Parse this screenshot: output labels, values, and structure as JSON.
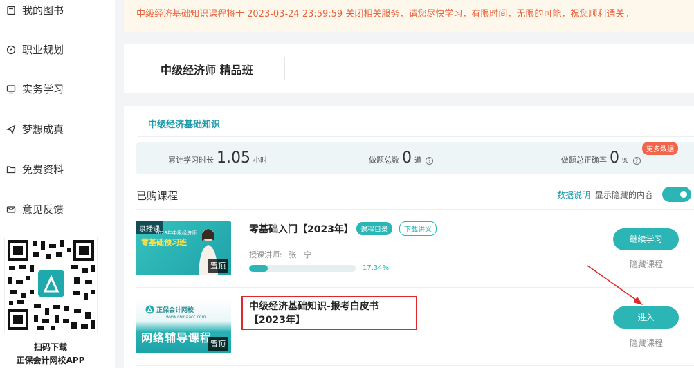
{
  "sidebar": {
    "items": [
      {
        "label": "我的图书",
        "icon": "book-icon"
      },
      {
        "label": "职业规划",
        "icon": "compass-icon"
      },
      {
        "label": "实务学习",
        "icon": "monitor-icon"
      },
      {
        "label": "梦想成真",
        "icon": "paper-plane-icon"
      },
      {
        "label": "免费资料",
        "icon": "folder-icon"
      },
      {
        "label": "意见反馈",
        "icon": "mail-icon"
      }
    ],
    "qr_caption_1": "扫码下载",
    "qr_caption_2": "正保会计网校APP"
  },
  "notice": {
    "text": "中级经济基础知识课程将于 2023-03-24 23:59:59 关闭相关服务，请您尽快学习，有限时间，无限的可能，祝您顺利通关。"
  },
  "course_header": {
    "title": "中级经济师 精品班"
  },
  "tab": {
    "label": "中级经济基础知识"
  },
  "stats": {
    "study_time_label": "累计学习时长",
    "study_time_value": "1.05",
    "study_time_unit": "小时",
    "questions_label": "做题总数",
    "questions_value": "0",
    "questions_unit": "道",
    "accuracy_label": "做题总正确率",
    "accuracy_value": "0",
    "accuracy_unit": "%",
    "more_badge": "更多数据"
  },
  "purchased": {
    "heading": "已购课程",
    "data_link": "数据说明",
    "show_hidden_label": "显示隐藏的内容",
    "show_hidden_on": true
  },
  "courses": [
    {
      "name": "零基础入门【2023年】",
      "pill_catalog": "课程目录",
      "pill_handout": "下载讲义",
      "teacher_label": "授课讲师:",
      "teacher_name": "张　宁",
      "progress_percent": 17.34,
      "progress_text": "17.34%",
      "thumb_tag": "录播课",
      "thumb_title": "零基础预习班",
      "thumb_sub": "2023年中级经济师",
      "cover_badge": "置顶",
      "button": "继续学习",
      "hide": "隐藏课程"
    },
    {
      "name": "中级经济基础知识-报考白皮书【2023年】",
      "thumb_logo": "正保会计网校",
      "thumb_sub": "www.chinaacc.com",
      "thumb_title": "网络辅导课程",
      "cover_badge": "置顶",
      "button": "进入",
      "hide": "隐藏课程"
    }
  ],
  "colors": {
    "accent": "#2bb5b5",
    "notice_text": "#e8643c",
    "notice_bg": "#fdf7ec",
    "highlight": "#e0282b",
    "badge": "#f0664a"
  }
}
